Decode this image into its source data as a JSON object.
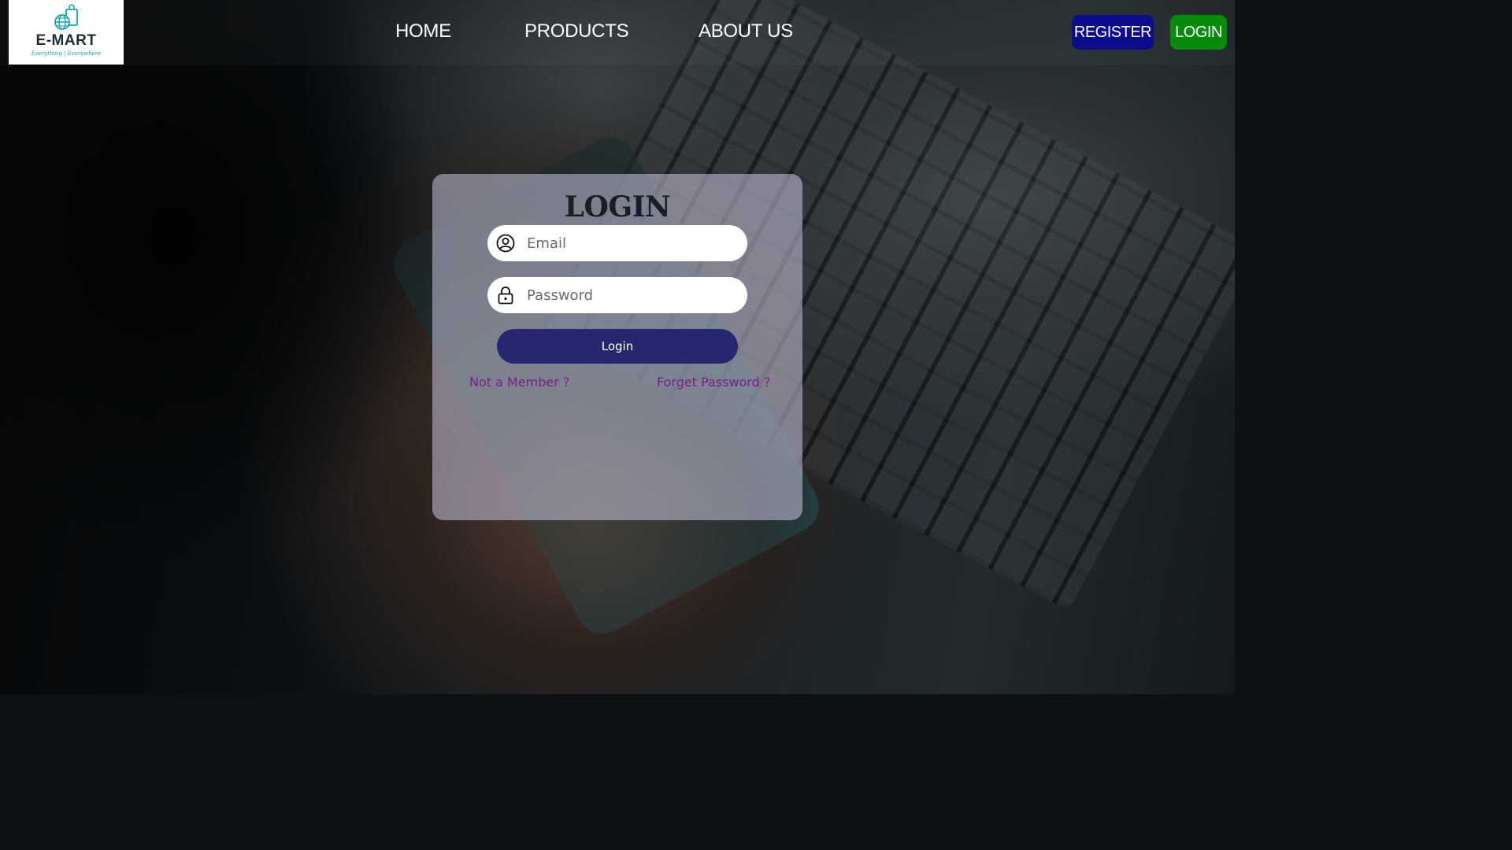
{
  "brand": {
    "name": "E-MART",
    "tagline": "Everything | Everywhere"
  },
  "nav": {
    "items": [
      {
        "label": "HOME"
      },
      {
        "label": "PRODUCTS"
      },
      {
        "label": "ABOUT US"
      }
    ]
  },
  "header_buttons": {
    "register_label": "REGISTER",
    "login_label": "LOGIN"
  },
  "login_form": {
    "title": "LOGIN",
    "email_placeholder": "Email",
    "password_placeholder": "Password",
    "submit_label": "Login",
    "not_member_link": "Not a Member ?",
    "forget_password_link": "Forget Password ?"
  },
  "colors": {
    "register_bg": "#0b0b8c",
    "login_top_bg": "#088a0a",
    "submit_bg": "#272670",
    "link_color": "#7a1f86",
    "logo_accent": "#1aa3a8"
  },
  "icons": {
    "logo": "shopping-bag-globe-icon",
    "email_field": "user-circle-icon",
    "password_field": "lock-icon"
  }
}
